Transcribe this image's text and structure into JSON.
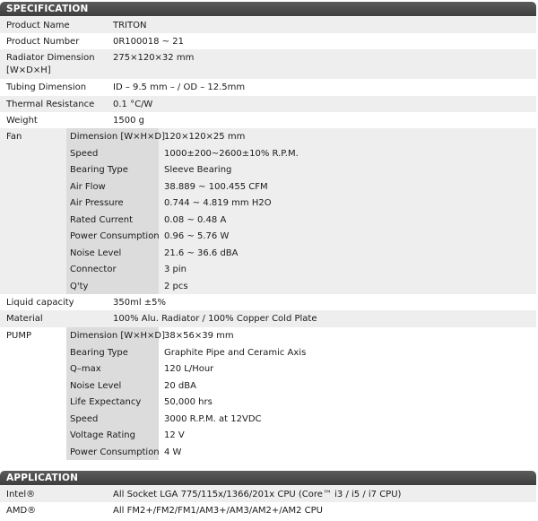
{
  "specification": {
    "header": "SPECIFICATION",
    "product_name": {
      "label": "Product Name",
      "value": "TRITON"
    },
    "product_number": {
      "label": "Product Number",
      "value": "0R100018 ~ 21"
    },
    "radiator_dimension": {
      "label_line1": "Radiator Dimension",
      "label_line2": "[W×D×H]",
      "value": "275×120×32 mm"
    },
    "tubing_dimension": {
      "label": "Tubing Dimension",
      "value": "ID – 9.5 mm – / OD – 12.5mm"
    },
    "thermal_resistance": {
      "label": "Thermal Resistance",
      "value": "0.1 °C/W"
    },
    "weight": {
      "label": "Weight",
      "value": "1500 g"
    },
    "fan": {
      "label": "Fan",
      "rows": [
        {
          "label": "Dimension [W×H×D]",
          "value": "120×120×25 mm"
        },
        {
          "label": "Speed",
          "value": "1000±200~2600±10% R.P.M."
        },
        {
          "label": "Bearing Type",
          "value": "Sleeve Bearing"
        },
        {
          "label": "Air Flow",
          "value": "38.889 ~ 100.455 CFM"
        },
        {
          "label": "Air Pressure",
          "value": "0.744 ~ 4.819 mm H2O"
        },
        {
          "label": "Rated Current",
          "value": "0.08 ~ 0.48 A"
        },
        {
          "label": "Power Consumption",
          "value": "0.96 ~ 5.76 W"
        },
        {
          "label": "Noise Level",
          "value": "21.6 ~ 36.6 dBA"
        },
        {
          "label": "Connector",
          "value": "3 pin"
        },
        {
          "label": "Q'ty",
          "value": "2 pcs"
        }
      ]
    },
    "liquid_capacity": {
      "label": "Liquid capacity",
      "value": "350ml ±5%"
    },
    "material": {
      "label": "Material",
      "value": "100% Alu. Radiator / 100% Copper Cold Plate"
    },
    "pump": {
      "label": "PUMP",
      "rows": [
        {
          "label": "Dimension [W×H×D]",
          "value": "38×56×39 mm"
        },
        {
          "label": "Bearing Type",
          "value": "Graphite Pipe and Ceramic Axis"
        },
        {
          "label": "Q–max",
          "value": "120 L/Hour"
        },
        {
          "label": "Noise Level",
          "value": "20 dBA"
        },
        {
          "label": "Life Expectancy",
          "value": "50,000 hrs"
        },
        {
          "label": "Speed",
          "value": "3000 R.P.M. at 12VDC"
        },
        {
          "label": "Voltage Rating",
          "value": "12 V"
        },
        {
          "label": "Power Consumption",
          "value": "4 W"
        }
      ]
    }
  },
  "application": {
    "header": "APPLICATION",
    "rows": [
      {
        "label": "Intel®",
        "value": "All Socket LGA 775/115x/1366/201x CPU (Core™ i3 / i5 / i7 CPU)"
      },
      {
        "label": "AMD®",
        "value": "All FM2+/FM2/FM1/AM3+/AM3/AM2+/AM2 CPU"
      }
    ]
  }
}
